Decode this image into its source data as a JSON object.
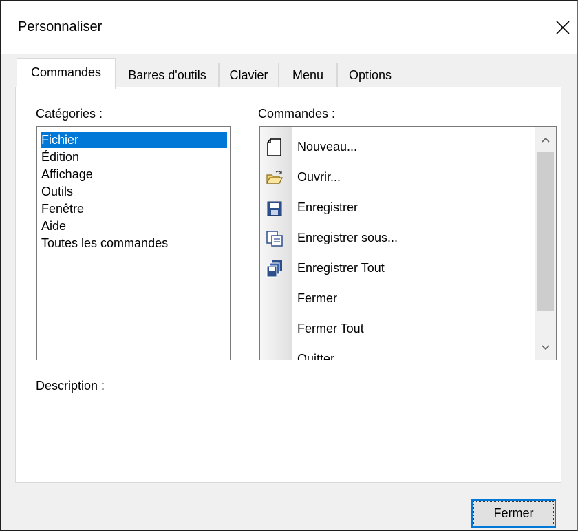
{
  "window": {
    "title": "Personnaliser",
    "close_symbol": "✕"
  },
  "tabs": [
    {
      "label": "Commandes",
      "active": true
    },
    {
      "label": "Barres d'outils",
      "active": false
    },
    {
      "label": "Clavier",
      "active": false
    },
    {
      "label": "Menu",
      "active": false
    },
    {
      "label": "Options",
      "active": false
    }
  ],
  "categories": {
    "label": "Catégories :",
    "items": [
      "Fichier",
      "Édition",
      "Affichage",
      "Outils",
      "Fenêtre",
      "Aide",
      "Toutes les commandes"
    ],
    "selected": "Fichier"
  },
  "commands": {
    "label": "Commandes :",
    "items": [
      {
        "label": "Nouveau...",
        "icon": "new-document-icon"
      },
      {
        "label": "Ouvrir...",
        "icon": "open-folder-icon"
      },
      {
        "label": "Enregistrer",
        "icon": "save-icon"
      },
      {
        "label": "Enregistrer sous...",
        "icon": "save-as-icon"
      },
      {
        "label": "Enregistrer Tout",
        "icon": "save-all-icon"
      },
      {
        "label": "Fermer",
        "icon": ""
      },
      {
        "label": "Fermer Tout",
        "icon": ""
      },
      {
        "label": "Quitter",
        "icon": ""
      }
    ]
  },
  "description": {
    "label": "Description :"
  },
  "footer": {
    "close_button": "Fermer"
  },
  "colors": {
    "selection": "#0078d7",
    "focus_border": "#0078d7"
  }
}
